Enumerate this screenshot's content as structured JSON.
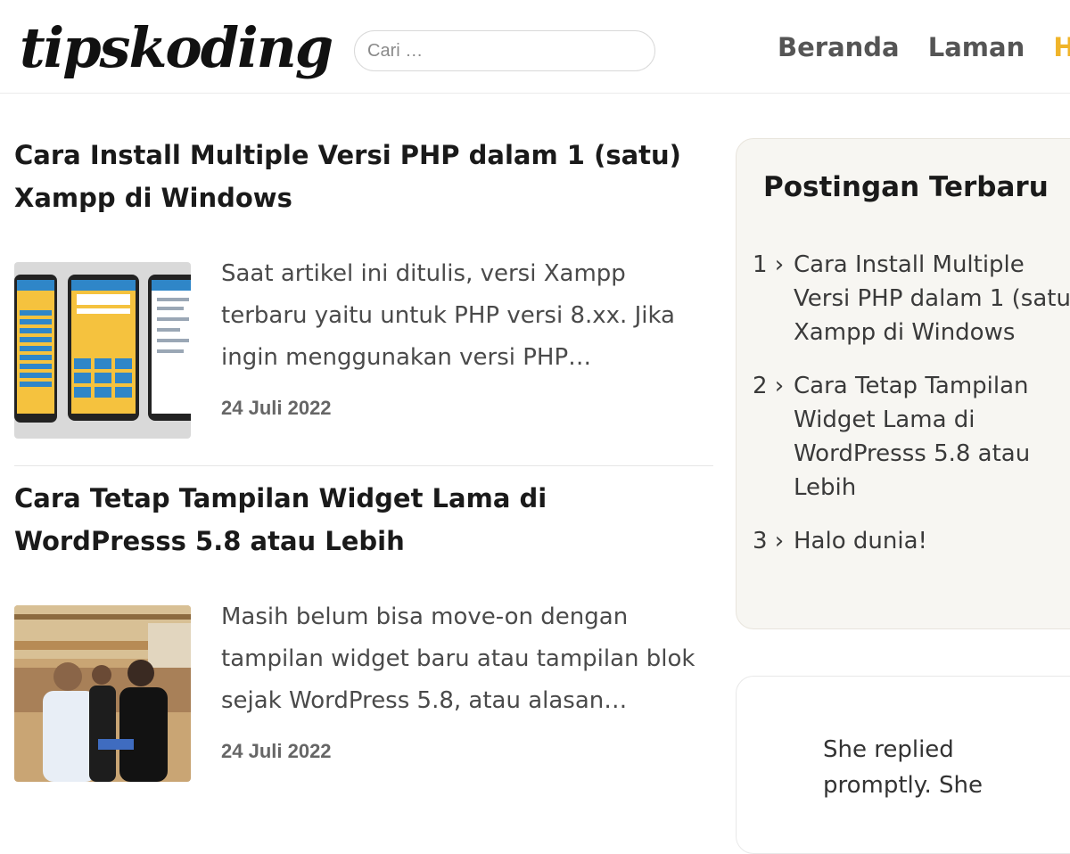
{
  "header": {
    "logo": "tipskoding",
    "search_placeholder": "Cari …",
    "nav": [
      "Beranda",
      "Laman",
      "Hub"
    ],
    "accent_color": "#f0b429"
  },
  "posts": [
    {
      "title": "Cara Install Multiple Versi PHP dalam 1 (satu) Xampp di Windows",
      "excerpt": "Saat artikel ini ditulis, versi Xampp terbaru yaitu untuk PHP versi 8.xx. Jika ingin menggunakan versi PHP…",
      "date": "24 Juli 2022",
      "thumbnail": "phone-app-screens"
    },
    {
      "title": "Cara Tetap Tampilan Widget Lama di WordPresss 5.8 atau Lebih",
      "excerpt": "Masih belum bisa move-on dengan tampilan widget baru atau tampilan blok sejak WordPress 5.8, atau alasan…",
      "date": "24 Juli 2022",
      "thumbnail": "people-photo"
    }
  ],
  "sidebar": {
    "recent_title": "Postingan Terbaru",
    "recent_items": [
      {
        "num": "1 ›",
        "label": "Cara Install Multiple Versi PHP dalam 1 (satu) Xampp di Windows"
      },
      {
        "num": "2 ›",
        "label": "Cara Tetap Tampilan Widget Lama di WordPresss 5.8 atau Lebih"
      },
      {
        "num": "3 ›",
        "label": "Halo dunia!"
      }
    ],
    "quote_text": "She replied promptly. She"
  }
}
